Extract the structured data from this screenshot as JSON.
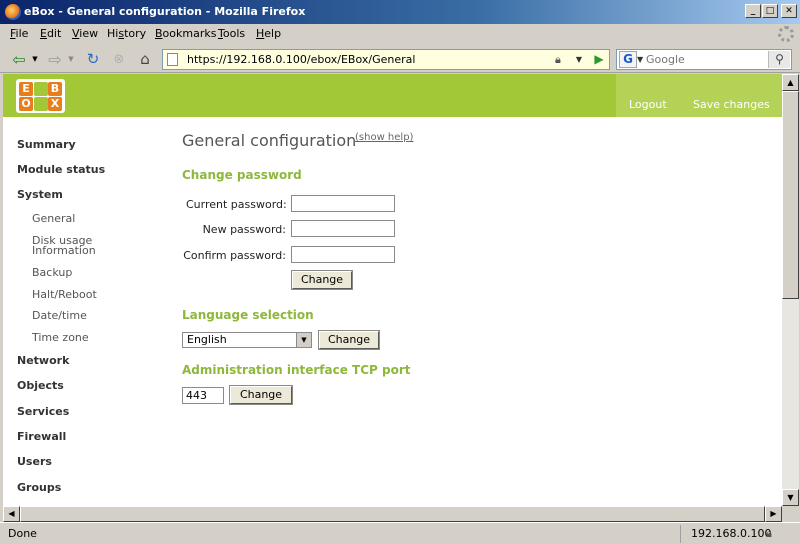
{
  "window": {
    "title": "eBox - General configuration - Mozilla Firefox"
  },
  "menu": [
    "File",
    "Edit",
    "View",
    "History",
    "Bookmarks",
    "Tools",
    "Help"
  ],
  "menu_accel": [
    "F",
    "E",
    "V",
    "s",
    "B",
    "T",
    "H"
  ],
  "nav": {
    "url": "https://192.168.0.100/ebox/EBox/General",
    "search_placeholder": "Google"
  },
  "header": {
    "logo_letters": [
      "E",
      "B",
      "O",
      "X"
    ],
    "logout": "Logout",
    "save": "Save changes"
  },
  "sidebar": {
    "items": [
      "Summary",
      "Module status",
      "System",
      "Network",
      "Objects",
      "Services",
      "Firewall",
      "Users",
      "Groups"
    ],
    "system_sub": [
      "General",
      "Disk usage",
      "Information",
      "Backup",
      "Halt/Reboot",
      "Date/time",
      "Time zone"
    ]
  },
  "main": {
    "title": "General configuration",
    "help": "(show help)",
    "password": {
      "title": "Change password",
      "current": "Current password:",
      "new": "New password:",
      "confirm": "Confirm password:",
      "button": "Change"
    },
    "language": {
      "title": "Language selection",
      "selected": "English",
      "button": "Change"
    },
    "port": {
      "title": "Administration interface TCP port",
      "value": "443",
      "button": "Change"
    }
  },
  "status": {
    "text": "Done",
    "host": "192.168.0.100"
  }
}
